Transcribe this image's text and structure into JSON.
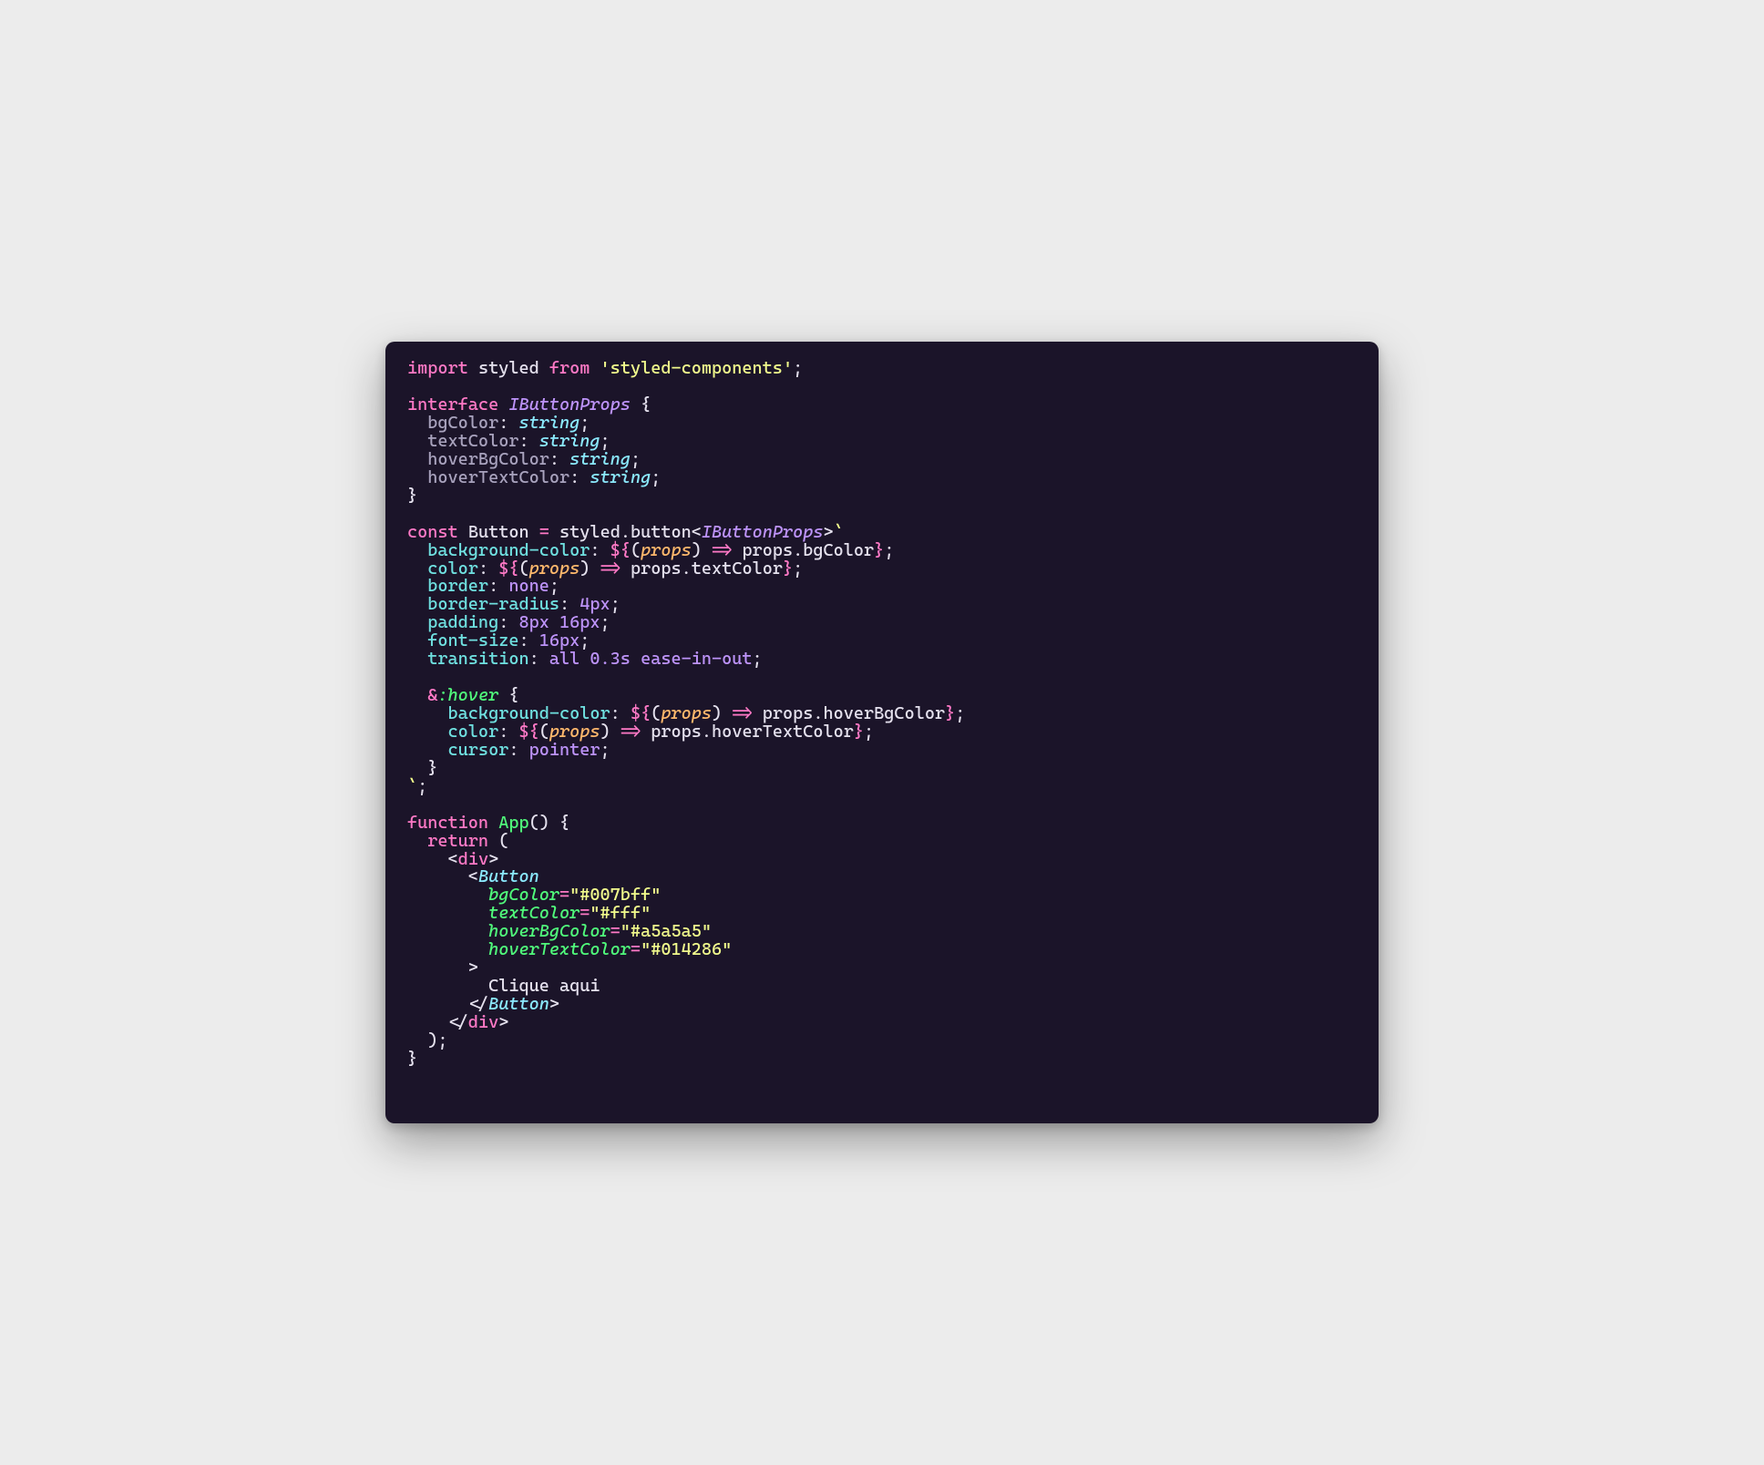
{
  "code": {
    "l01": {
      "kw1": "import",
      "id1": "styled",
      "kw2": "from",
      "str1": "'styled-components'",
      "semi": ";"
    },
    "l02": {
      "kw1": "interface",
      "type1": "IButtonProps",
      "brace": "{"
    },
    "l03": {
      "prop": "bgColor",
      "punc": ":",
      "type": "string",
      "semi": ";"
    },
    "l04": {
      "prop": "textColor",
      "punc": ":",
      "type": "string",
      "semi": ";"
    },
    "l05": {
      "prop": "hoverBgColor",
      "punc": ":",
      "type": "string",
      "semi": ";"
    },
    "l06": {
      "prop": "hoverTextColor",
      "punc": ":",
      "type": "string",
      "semi": ";"
    },
    "l07": {
      "brace": "}"
    },
    "l08": {
      "kw1": "const",
      "id1": "Button",
      "eq": "=",
      "id2": "styled.button",
      "lt": "<",
      "type": "IButtonProps",
      "gt": ">",
      "bt": "`"
    },
    "l09": {
      "prop": "background-color",
      "col": ":",
      "d1": "${",
      "p1": "(",
      "param": "props",
      "p2": ")",
      "arrow": "=>",
      "expr": "props.bgColor",
      "d2": "}",
      "semi": ";"
    },
    "l10": {
      "prop": "color",
      "col": ":",
      "d1": "${",
      "p1": "(",
      "param": "props",
      "p2": ")",
      "arrow": "=>",
      "expr": "props.textColor",
      "d2": "}",
      "semi": ";"
    },
    "l11": {
      "prop": "border",
      "col": ":",
      "val": "none",
      "semi": ";"
    },
    "l12": {
      "prop": "border-radius",
      "col": ":",
      "val": "4px",
      "semi": ";"
    },
    "l13": {
      "prop": "padding",
      "col": ":",
      "val": "8px 16px",
      "semi": ";"
    },
    "l14": {
      "prop": "font-size",
      "col": ":",
      "val": "16px",
      "semi": ";"
    },
    "l15": {
      "prop": "transition",
      "col": ":",
      "val": "all 0.3s ease-in-out",
      "semi": ";"
    },
    "l16": {
      "amp": "&",
      "pseudo": ":hover",
      "brace": "{"
    },
    "l17": {
      "prop": "background-color",
      "col": ":",
      "d1": "${",
      "p1": "(",
      "param": "props",
      "p2": ")",
      "arrow": "=>",
      "expr": "props.hoverBgColor",
      "d2": "}",
      "semi": ";"
    },
    "l18": {
      "prop": "color",
      "col": ":",
      "d1": "${",
      "p1": "(",
      "param": "props",
      "p2": ")",
      "arrow": "=>",
      "expr": "props.hoverTextColor",
      "d2": "}",
      "semi": ";"
    },
    "l19": {
      "prop": "cursor",
      "col": ":",
      "val": "pointer",
      "semi": ";"
    },
    "l20": {
      "brace": "}"
    },
    "l21": {
      "bt": "`",
      "semi": ";"
    },
    "l22": {
      "kw1": "function",
      "fn": "App",
      "parens": "()",
      "brace": "{"
    },
    "l23": {
      "kw1": "return",
      "paren": "("
    },
    "l24": {
      "lt": "<",
      "tag": "div",
      "gt": ">"
    },
    "l25": {
      "lt": "<",
      "comp": "Button"
    },
    "l26": {
      "attr": "bgColor",
      "eq": "=",
      "val": "\"#007bff\""
    },
    "l27": {
      "attr": "textColor",
      "eq": "=",
      "val": "\"#fff\""
    },
    "l28": {
      "attr": "hoverBgColor",
      "eq": "=",
      "val": "\"#a5a5a5\""
    },
    "l29": {
      "attr": "hoverTextColor",
      "eq": "=",
      "val": "\"#014286\""
    },
    "l30": {
      "gt": ">"
    },
    "l31": {
      "text": "Clique aqui"
    },
    "l32": {
      "lt": "</",
      "comp": "Button",
      "gt": ">"
    },
    "l33": {
      "lt": "</",
      "tag": "div",
      "gt": ">"
    },
    "l34": {
      "paren": ")",
      "semi": ";"
    },
    "l35": {
      "brace": "}"
    }
  }
}
